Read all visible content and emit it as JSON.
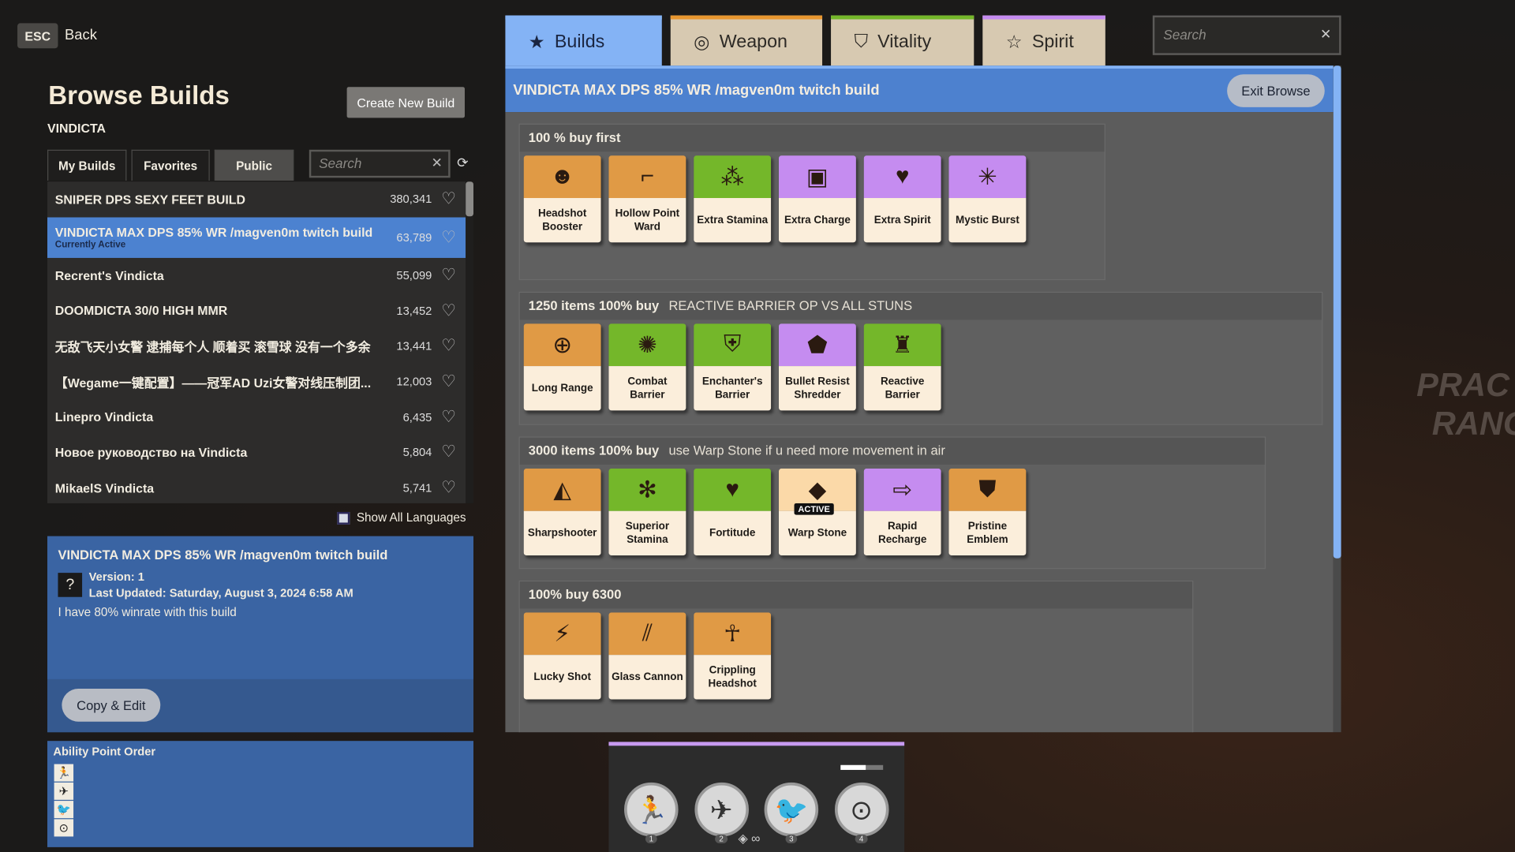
{
  "left": {
    "esc_label": "ESC",
    "back_label": "Back",
    "title": "Browse Builds",
    "hero": "VINDICTA",
    "create_label": "Create New Build",
    "tabs": [
      {
        "label": "My Builds"
      },
      {
        "label": "Favorites"
      },
      {
        "label": "Public"
      }
    ],
    "active_tab": "Public",
    "search_placeholder": "Search",
    "builds": [
      {
        "name": "SNIPER DPS SEXY FEET BUILD",
        "count": "380,341"
      },
      {
        "name": "VINDICTA MAX DPS 85% WR /magven0m twitch build",
        "count": "63,789",
        "sub": "Currently Active"
      },
      {
        "name": "Recrent's Vindicta",
        "count": "55,099"
      },
      {
        "name": "DOOMDICTA 30/0 HIGH MMR",
        "count": "13,452"
      },
      {
        "name": "无敌飞天小女警 逮捕每个人 顺着买 滚雪球 没有一个多余",
        "count": "13,441"
      },
      {
        "name": "【Wegame一键配置】——冠军AD Uzi女警对线压制团...",
        "count": "12,003"
      },
      {
        "name": "Linepro Vindicta",
        "count": "6,435"
      },
      {
        "name": "Новое руководство на Vindicta",
        "count": "5,804"
      },
      {
        "name": "MikaelS Vindicta",
        "count": "5,741"
      }
    ],
    "show_all_languages": "Show All Languages",
    "show_all_languages_checked": false,
    "info": {
      "title": "VINDICTA MAX DPS 85% WR /magven0m twitch build",
      "version": "Version: 1",
      "updated": "Last Updated: Saturday, August 3, 2024 6:58 AM",
      "description": "I have 80% winrate with this build",
      "copy_label": "Copy & Edit",
      "avatar": "?"
    },
    "ability_order_title": "Ability Point Order"
  },
  "right": {
    "tabs": [
      {
        "label": "Builds",
        "icon": "★",
        "color": "#84b3f5"
      },
      {
        "label": "Weapon",
        "icon": "◎",
        "color": "#e8962f"
      },
      {
        "label": "Vitality",
        "icon": "⛉",
        "color": "#74b72a"
      },
      {
        "label": "Spirit",
        "icon": "☆",
        "color": "#c58cf0"
      }
    ],
    "search_placeholder": "Search",
    "build_title": "VINDICTA MAX DPS 85% WR /magven0m twitch build",
    "exit_label": "Exit Browse",
    "sections": [
      {
        "title": "100 % buy first",
        "note": "",
        "items": [
          {
            "name": "Headshot Booster",
            "color": "#e09a45",
            "icon": "☻"
          },
          {
            "name": "Hollow Point Ward",
            "color": "#e09a45",
            "icon": "⌐"
          },
          {
            "name": "Extra Stamina",
            "color": "#74b72a",
            "icon": "⁂"
          },
          {
            "name": "Extra Charge",
            "color": "#c58cf0",
            "icon": "▣"
          },
          {
            "name": "Extra Spirit",
            "color": "#c58cf0",
            "icon": "♥"
          },
          {
            "name": "Mystic Burst",
            "color": "#c58cf0",
            "icon": "✳"
          }
        ]
      },
      {
        "title": "1250 items  100% buy",
        "note": "REACTIVE BARRIER OP VS ALL STUNS",
        "items": [
          {
            "name": "Long Range",
            "color": "#e09a45",
            "icon": "⊕"
          },
          {
            "name": "Combat Barrier",
            "color": "#74b72a",
            "icon": "✺"
          },
          {
            "name": "Enchanter's Barrier",
            "color": "#74b72a",
            "icon": "⛨"
          },
          {
            "name": "Bullet Resist Shredder",
            "color": "#c58cf0",
            "icon": "⬟"
          },
          {
            "name": "Reactive Barrier",
            "color": "#74b72a",
            "icon": "♜"
          }
        ]
      },
      {
        "title": "3000 items 100% buy",
        "note": "use Warp Stone if u need more movement in air",
        "items": [
          {
            "name": "Sharpshooter",
            "color": "#e09a45",
            "icon": "◭"
          },
          {
            "name": "Superior Stamina",
            "color": "#74b72a",
            "icon": "✻"
          },
          {
            "name": "Fortitude",
            "color": "#74b72a",
            "icon": "♥"
          },
          {
            "name": "Warp Stone",
            "color": "#fbd9a8",
            "icon": "◆",
            "badge": "ACTIVE"
          },
          {
            "name": "Rapid Recharge",
            "color": "#c58cf0",
            "icon": "⇨"
          },
          {
            "name": "Pristine Emblem",
            "color": "#e09a45",
            "icon": "⛊"
          }
        ]
      },
      {
        "title": "100% buy 6300",
        "note": "",
        "items": [
          {
            "name": "Lucky Shot",
            "color": "#e09a45",
            "icon": "⚡"
          },
          {
            "name": "Glass Cannon",
            "color": "#e09a45",
            "icon": "⫽"
          },
          {
            "name": "Crippling Headshot",
            "color": "#e09a45",
            "icon": "☥"
          }
        ]
      }
    ]
  },
  "abilities": [
    {
      "num": "1",
      "icon": "🏃"
    },
    {
      "num": "2",
      "icon": "✈"
    },
    {
      "num": "3",
      "icon": "🐦"
    },
    {
      "num": "4",
      "icon": "⊙"
    }
  ],
  "background_text": [
    "PRAC",
    "RANG"
  ]
}
